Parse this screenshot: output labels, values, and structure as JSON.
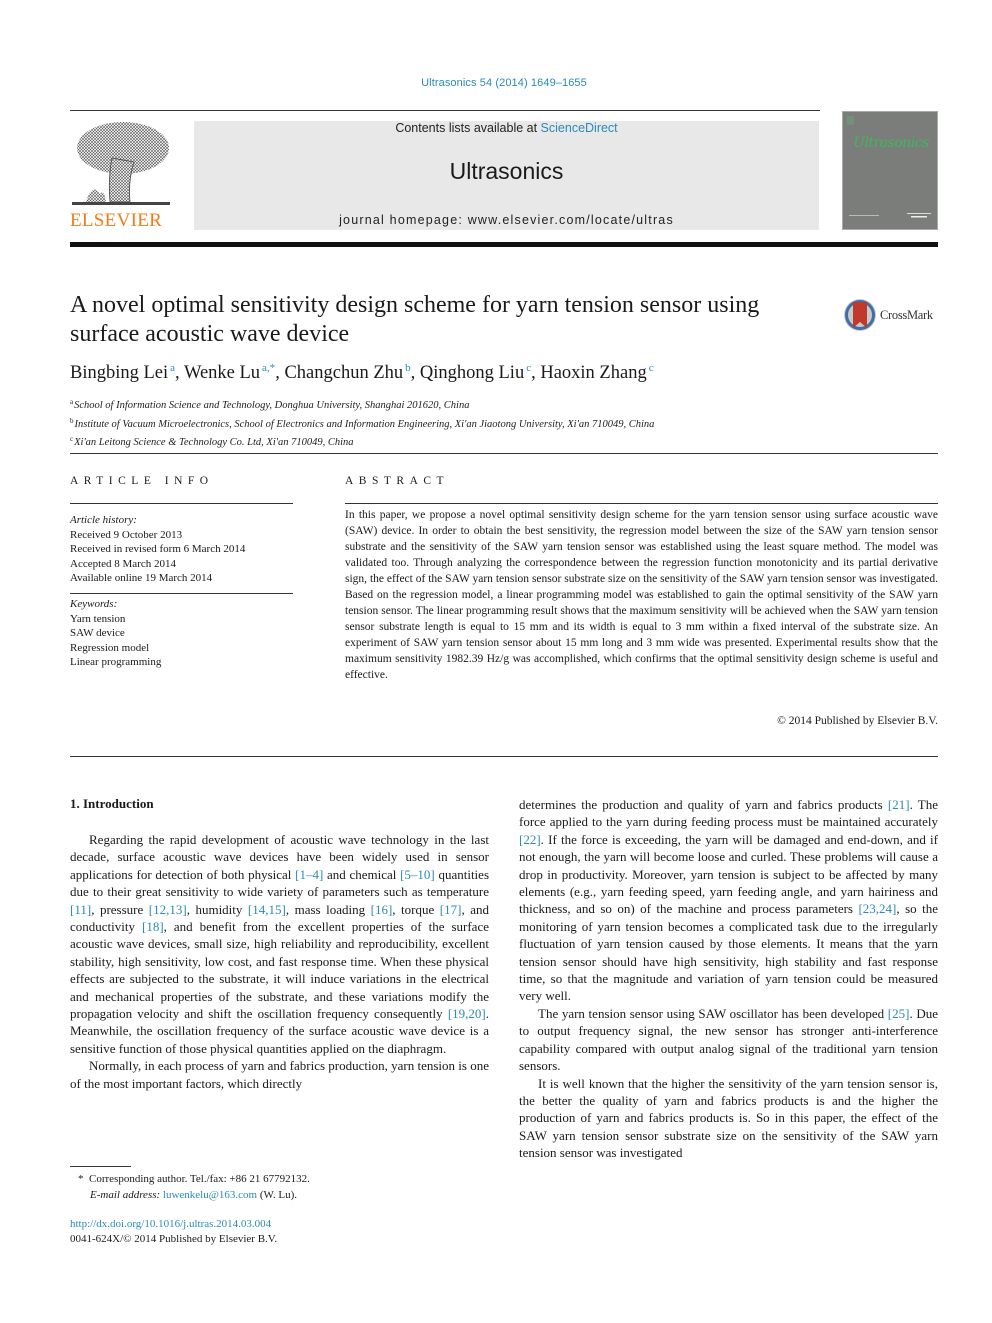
{
  "header": {
    "journal_ref": "Ultrasonics 54 (2014) 1649–1655",
    "contents_prefix": "Contents lists available at ",
    "contents_link": "ScienceDirect",
    "journal_name": "Ultrasonics",
    "homepage_prefix": "journal homepage: ",
    "homepage_url": "www.elsevier.com/locate/ultras",
    "publisher_wordmark": "ELSEVIER",
    "cover_title": "Ultrasonics",
    "colors": {
      "link": "#2a8ab8",
      "elsevier_orange": "#f07d19",
      "cover_bg": "#7b7d7b",
      "cover_text": "#3db85a",
      "masthead_bg": "#e8e8e8"
    }
  },
  "article": {
    "title": "A novel optimal sensitivity design scheme for yarn tension sensor using surface acoustic wave device",
    "crossmark_label": "CrossMark",
    "authors": [
      {
        "name": "Bingbing Lei",
        "sup": "a"
      },
      {
        "name": "Wenke Lu",
        "sup": "a,*"
      },
      {
        "name": "Changchun Zhu",
        "sup": "b"
      },
      {
        "name": "Qinghong Liu",
        "sup": "c"
      },
      {
        "name": "Haoxin Zhang",
        "sup": "c"
      }
    ],
    "affiliations": [
      {
        "key": "a",
        "text": "School of Information Science and Technology, Donghua University, Shanghai 201620, China"
      },
      {
        "key": "b",
        "text": "Institute of Vacuum Microelectronics, School of Electronics and Information Engineering, Xi'an Jiaotong University, Xi'an 710049, China"
      },
      {
        "key": "c",
        "text": "Xi'an Leitong Science & Technology Co. Ltd, Xi'an 710049, China"
      }
    ]
  },
  "article_info": {
    "heading": "ARTICLE INFO",
    "history_label": "Article history:",
    "history": [
      "Received 9 October 2013",
      "Received in revised form 6 March 2014",
      "Accepted 8 March 2014",
      "Available online 19 March 2014"
    ],
    "keywords_label": "Keywords:",
    "keywords": [
      "Yarn tension",
      "SAW device",
      "Regression model",
      "Linear programming"
    ]
  },
  "abstract": {
    "heading": "ABSTRACT",
    "text": "In this paper, we propose a novel optimal sensitivity design scheme for the yarn tension sensor using surface acoustic wave (SAW) device. In order to obtain the best sensitivity, the regression model between the size of the SAW yarn tension sensor substrate and the sensitivity of the SAW yarn tension sensor was established using the least square method. The model was validated too. Through analyzing the correspondence between the regression function monotonicity and its partial derivative sign, the effect of the SAW yarn tension sensor substrate size on the sensitivity of the SAW yarn tension sensor was investigated. Based on the regression model, a linear programming model was established to gain the optimal sensitivity of the SAW yarn tension sensor. The linear programming result shows that the maximum sensitivity will be achieved when the SAW yarn tension sensor substrate length is equal to 15 mm and its width is equal to 3 mm within a fixed interval of the substrate size. An experiment of SAW yarn tension sensor about 15 mm long and 3 mm wide was presented. Experimental results show that the maximum sensitivity 1982.39 Hz/g was accomplished, which confirms that the optimal sensitivity design scheme is useful and effective.",
    "copyright": "© 2014 Published by Elsevier B.V."
  },
  "body": {
    "section_heading": "1. Introduction",
    "left": {
      "p1": [
        {
          "t": "Regarding the rapid development of acoustic wave technology in the last decade, surface acoustic wave devices have been widely used in sensor applications for detection of both physical "
        },
        {
          "ref": "[1–4]"
        },
        {
          "t": " and chemical "
        },
        {
          "ref": "[5–10]"
        },
        {
          "t": " quantities due to their great sensitivity to wide variety of parameters such as temperature "
        },
        {
          "ref": "[11]"
        },
        {
          "t": ", pressure "
        },
        {
          "ref": "[12,13]"
        },
        {
          "t": ", humidity "
        },
        {
          "ref": "[14,15]"
        },
        {
          "t": ", mass loading "
        },
        {
          "ref": "[16]"
        },
        {
          "t": ", torque "
        },
        {
          "ref": "[17]"
        },
        {
          "t": ", and conductivity "
        },
        {
          "ref": "[18]"
        },
        {
          "t": ", and benefit from the excellent properties of the surface acoustic wave devices, small size, high reliability and reproducibility, excellent stability, high sensitivity, low cost, and fast response time. When these physical effects are subjected to the substrate, it will induce variations in the electrical and mechanical properties of the substrate, and these variations modify the propagation velocity and shift the oscillation frequency consequently "
        },
        {
          "ref": "[19,20]"
        },
        {
          "t": ". Meanwhile, the oscillation frequency of the surface acoustic wave device is a sensitive function of those physical quantities applied on the diaphragm."
        }
      ],
      "p2": [
        {
          "t": "Normally, in each process of yarn and fabrics production, yarn tension is one of the most important factors, which directly"
        }
      ]
    },
    "right": {
      "p1": [
        {
          "t": "determines the production and quality of yarn and fabrics products "
        },
        {
          "ref": "[21]"
        },
        {
          "t": ". The force applied to the yarn during feeding process must be maintained accurately "
        },
        {
          "ref": "[22]"
        },
        {
          "t": ". If the force is exceeding, the yarn will be damaged and end-down, and if not enough, the yarn will become loose and curled. These problems will cause a drop in productivity. Moreover, yarn tension is subject to be affected by many elements (e.g., yarn feeding speed, yarn feeding angle, and yarn hairiness and thickness, and so on) of the machine and process parameters "
        },
        {
          "ref": "[23,24]"
        },
        {
          "t": ", so the monitoring of yarn tension becomes a complicated task due to the irregularly fluctuation of yarn tension caused by those elements. It means that the yarn tension sensor should have high sensitivity, high stability and fast response time, so that the magnitude and variation of yarn tension could be measured very well."
        }
      ],
      "p2": [
        {
          "t": "The yarn tension sensor using SAW oscillator has been developed "
        },
        {
          "ref": "[25]"
        },
        {
          "t": ". Due to output frequency signal, the new sensor has stronger anti-interference capability compared with output analog signal of the traditional yarn tension sensors."
        }
      ],
      "p3": [
        {
          "t": "It is well known that the higher the sensitivity of the yarn tension sensor is, the better the quality of yarn and fabrics products is and the higher the production of yarn and fabrics products is. So in this paper, the effect of the SAW yarn tension sensor substrate size on the sensitivity of the SAW yarn tension sensor was investigated"
        }
      ]
    }
  },
  "footnotes": {
    "star": "*",
    "corresponding": "Corresponding author. Tel./fax: +86 21 67792132.",
    "email_label": "E-mail address:",
    "email": "luwenkelu@163.com",
    "email_suffix": " (W. Lu).",
    "doi": "http://dx.doi.org/10.1016/j.ultras.2014.03.004",
    "issn_line": "0041-624X/© 2014 Published by Elsevier B.V."
  }
}
